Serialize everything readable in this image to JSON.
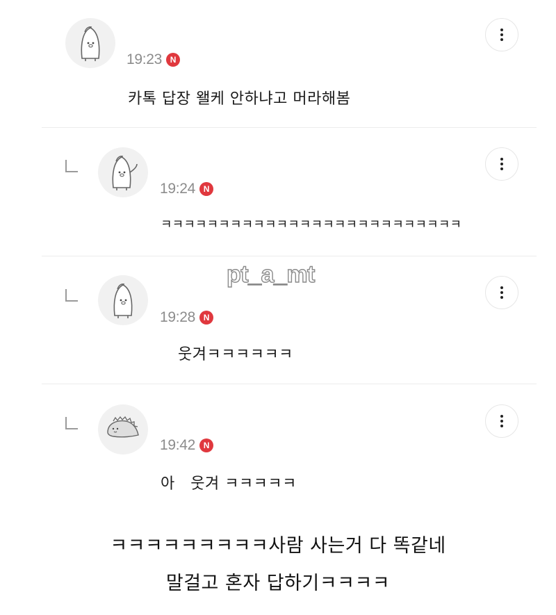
{
  "comments": [
    {
      "time": "19:23",
      "badge": "N",
      "text": "카톡 답장 왤케 안하냐고 머라해봄",
      "avatar_icon": "penguin-avatar-icon",
      "reply": false
    },
    {
      "time": "19:24",
      "badge": "N",
      "text": "ㅋㅋㅋㅋㅋㅋㅋㅋㅋㅋㅋㅋㅋㅋㅋㅋㅋㅋㅋㅋㅋㅋㅋㅋㅋㅋ",
      "avatar_icon": "penguin-waving-avatar-icon",
      "reply": true
    },
    {
      "time": "19:28",
      "badge": "N",
      "text": "웃겨ㅋㅋㅋㅋㅋㅋ",
      "avatar_icon": "penguin-avatar-icon",
      "reply": true
    },
    {
      "time": "19:42",
      "badge": "N",
      "text": "아   웃겨 ㅋㅋㅋㅋㅋ",
      "avatar_icon": "dinosaur-avatar-icon",
      "reply": true
    }
  ],
  "watermark": "pt_a_mt",
  "caption": {
    "line1": "ㅋㅋㅋㅋㅋㅋㅋㅋㅋ사람 사는거 다 똑같네",
    "line2": "말걸고 혼자 답하기ㅋㅋㅋㅋ"
  },
  "colors": {
    "badge": "#e0383e",
    "time": "#8c8c8c",
    "divider": "#ececec",
    "background": "#ffffff"
  }
}
